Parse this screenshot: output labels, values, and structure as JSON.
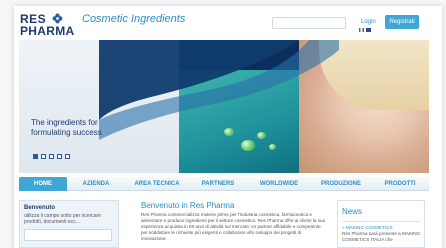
{
  "header": {
    "logo_line1": "RES",
    "logo_line2": "PHARMA",
    "tagline": "Cosmetic Ingredients",
    "search_placeholder": "",
    "login_label": "Login",
    "register_label": "Registrati"
  },
  "hero": {
    "caption_line1": "The ingredients for",
    "caption_line2": "formulating success",
    "slides": [
      true,
      false,
      false,
      false,
      false
    ]
  },
  "nav": {
    "items": [
      {
        "label": "HOME",
        "active": true
      },
      {
        "label": "AZIENDA",
        "active": false
      },
      {
        "label": "AREA TECNICA",
        "active": false
      },
      {
        "label": "PARTNERS",
        "active": false
      },
      {
        "label": "WORLDWIDE",
        "active": false
      },
      {
        "label": "PRODUZIONE",
        "active": false
      },
      {
        "label": "PRODOTTI",
        "active": false
      }
    ]
  },
  "sidebar": {
    "title": "Benvenuto",
    "text": "utilizza il campo sotto per ricercare prodotti, documenti ecc..."
  },
  "welcome": {
    "title": "Benvenuto in Res Pharma",
    "text": "Res Pharma commercializza materie prime per l'industria cosmetica, farmaceutica e alimentare e produce ingredienti per il settore cosmetico. Res Pharma offre ai clienti la sua esperienza acquisita in 50 anni di attività sul mercato; un partner affidabile e competente per soddisfare le richieste più esigenti e collaborare allo sviluppo dei progetti di innovazione."
  },
  "news": {
    "title": "News",
    "item_title": "» MAKING COSMETICS",
    "item_text": "Res Pharma sarà presente a MAKING COSMETICS ITALIA che"
  },
  "colors": {
    "accent": "#3fa7d6",
    "brand": "#1d3b6d",
    "link": "#2a8fc7"
  }
}
